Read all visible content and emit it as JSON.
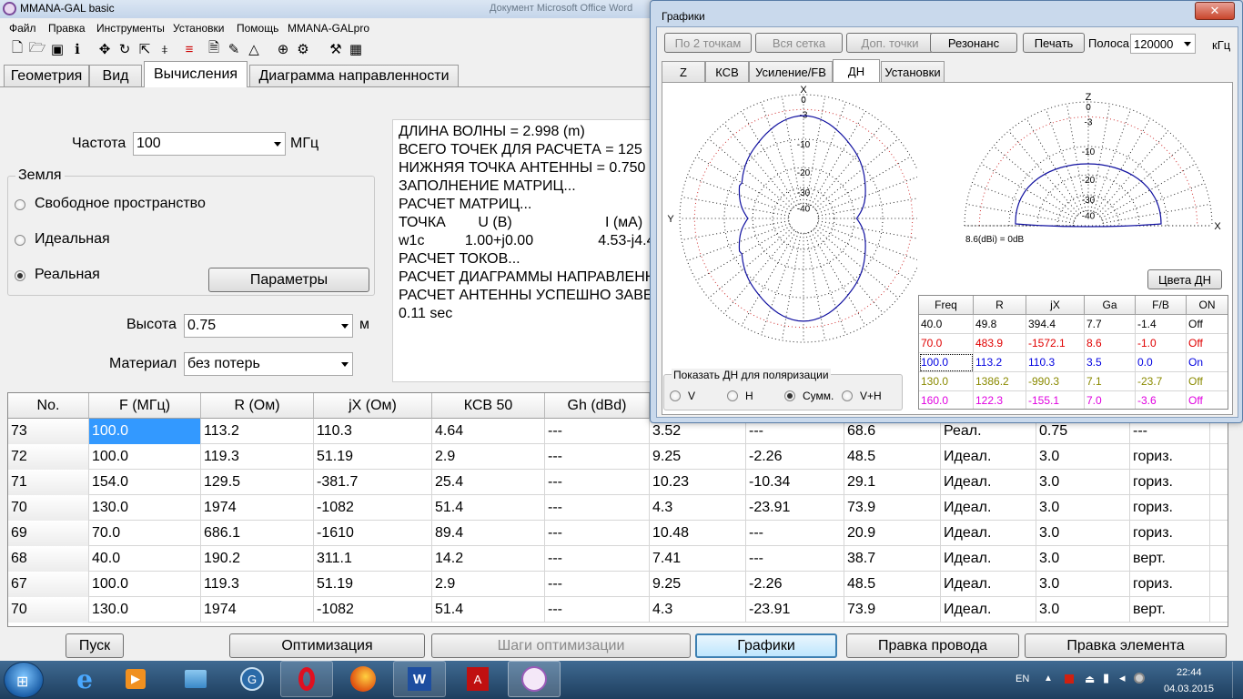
{
  "main_window": {
    "title": "MMANA-GAL basic",
    "behind_title": "Документ Microsoft Office Word"
  },
  "menu": [
    "Файл",
    "Правка",
    "Инструменты",
    "Установки",
    "Помощь",
    "MMANA-GALpro"
  ],
  "tabs": [
    "Геометрия",
    "Вид",
    "Вычисления",
    "Диаграмма направленности"
  ],
  "calc": {
    "freq_label": "Частота",
    "freq_value": "100",
    "freq_unit": "МГц",
    "ground_label": "Земля",
    "ground_options": [
      "Свободное пространство",
      "Идеальная",
      "Реальная"
    ],
    "ground_selected": "Реальная",
    "params_button": "Параметры",
    "height_label": "Высота",
    "height_value": "0.75",
    "height_unit": "м",
    "material_label": "Материал",
    "material_value": "без потерь"
  },
  "log_lines": [
    "ДЛИНА ВОЛНЫ = 2.998 (m)",
    "ВСЕГО ТОЧЕК ДЛЯ РАСЧЕТА = 125",
    "НИЖНЯЯ ТОЧКА АНТЕННЫ = 0.750",
    "ЗАПОЛНЕНИЕ МАТРИЦ...",
    "РАСЧЕТ МАТРИЦ...",
    "ТОЧКА        U (B)                       I (мА)",
    "w1c          1.00+j0.00                4.53-j4.4",
    "РАСЧЕТ ТОКОВ...",
    "РАСЧЕТ ДИАГРАММЫ НАПРАВЛЕНН",
    "РАСЧЕТ АНТЕННЫ УСПЕШНО ЗАВЕ",
    "0.11 sec"
  ],
  "table": {
    "headers": [
      "No.",
      "F (МГц)",
      "R (Ом)",
      "jX (Ом)",
      "КСВ 50",
      "Gh (dBd)",
      "",
      "",
      "",
      "",
      "",
      ""
    ],
    "rows": [
      [
        "73",
        "100.0",
        "113.2",
        "110.3",
        "4.64",
        "---",
        "3.52",
        "---",
        "68.6",
        "Реал.",
        "0.75",
        "---"
      ],
      [
        "72",
        "100.0",
        "119.3",
        "51.19",
        "2.9",
        "---",
        "9.25",
        "-2.26",
        "48.5",
        "Идеал.",
        "3.0",
        "гориз."
      ],
      [
        "71",
        "154.0",
        "129.5",
        "-381.7",
        "25.4",
        "---",
        "10.23",
        "-10.34",
        "29.1",
        "Идеал.",
        "3.0",
        "гориз."
      ],
      [
        "70",
        "130.0",
        "1974",
        "-1082",
        "51.4",
        "---",
        "4.3",
        "-23.91",
        "73.9",
        "Идеал.",
        "3.0",
        "гориз."
      ],
      [
        "69",
        "70.0",
        "686.1",
        "-1610",
        "89.4",
        "---",
        "10.48",
        "---",
        "20.9",
        "Идеал.",
        "3.0",
        "гориз."
      ],
      [
        "68",
        "40.0",
        "190.2",
        "311.1",
        "14.2",
        "---",
        "7.41",
        "---",
        "38.7",
        "Идеал.",
        "3.0",
        "верт."
      ],
      [
        "67",
        "100.0",
        "119.3",
        "51.19",
        "2.9",
        "---",
        "9.25",
        "-2.26",
        "48.5",
        "Идеал.",
        "3.0",
        "гориз."
      ],
      [
        "70",
        "130.0",
        "1974",
        "-1082",
        "51.4",
        "---",
        "4.3",
        "-23.91",
        "73.9",
        "Идеал.",
        "3.0",
        "верт."
      ]
    ]
  },
  "bottom_buttons": [
    "Пуск",
    "Оптимизация",
    "Шаги оптимизации",
    "Графики",
    "Правка провода",
    "Правка элемента"
  ],
  "graphs": {
    "title": "Графики",
    "buttons": [
      "По 2 точкам",
      "Вся сетка",
      "Доп. точки",
      "Резонанс",
      "Печать"
    ],
    "band_label": "Полоса",
    "band_value": "120000",
    "band_unit": "кГц",
    "tabs": [
      "Z",
      "КСВ",
      "Усиление/FB",
      "ДН",
      "Установки"
    ],
    "active_tab": "ДН",
    "polar": {
      "left_axis_top": "X",
      "left_axis_left": "Y",
      "right_axis_top": "Z",
      "right_axis_right": "X",
      "ring_labels": [
        "0",
        "-3",
        "-10",
        "-20",
        "-30",
        "-40"
      ],
      "gain_note": "8.6(dBi) = 0dB"
    },
    "colors_button": "Цвета ДН",
    "result_headers": [
      "Freq",
      "R",
      "jX",
      "Ga",
      "F/B",
      "ON"
    ],
    "results": [
      {
        "cells": [
          "40.0",
          "49.8",
          "394.4",
          "7.7",
          "-1.4",
          "Off"
        ],
        "color": "#000000"
      },
      {
        "cells": [
          "70.0",
          "483.9",
          "-1572.1",
          "8.6",
          "-1.0",
          "Off"
        ],
        "color": "#e00000"
      },
      {
        "cells": [
          "100.0",
          "113.2",
          "110.3",
          "3.5",
          "0.0",
          "On"
        ],
        "color": "#0000e0"
      },
      {
        "cells": [
          "130.0",
          "1386.2",
          "-990.3",
          "7.1",
          "-23.7",
          "Off"
        ],
        "color": "#8a8a00"
      },
      {
        "cells": [
          "160.0",
          "122.3",
          "-155.1",
          "7.0",
          "-3.6",
          "Off"
        ],
        "color": "#e000e0"
      }
    ],
    "polarization_label": "Показать ДН для поляризации",
    "polarization_options": [
      "V",
      "H",
      "Сумм.",
      "V+H"
    ],
    "polarization_selected": "Сумм."
  },
  "taskbar": {
    "lang": "EN",
    "time": "22:44",
    "date": "04.03.2015"
  },
  "colors": {
    "selection": "#3399ff",
    "pattern": "#1010a0",
    "grid_red": "#d03030"
  }
}
